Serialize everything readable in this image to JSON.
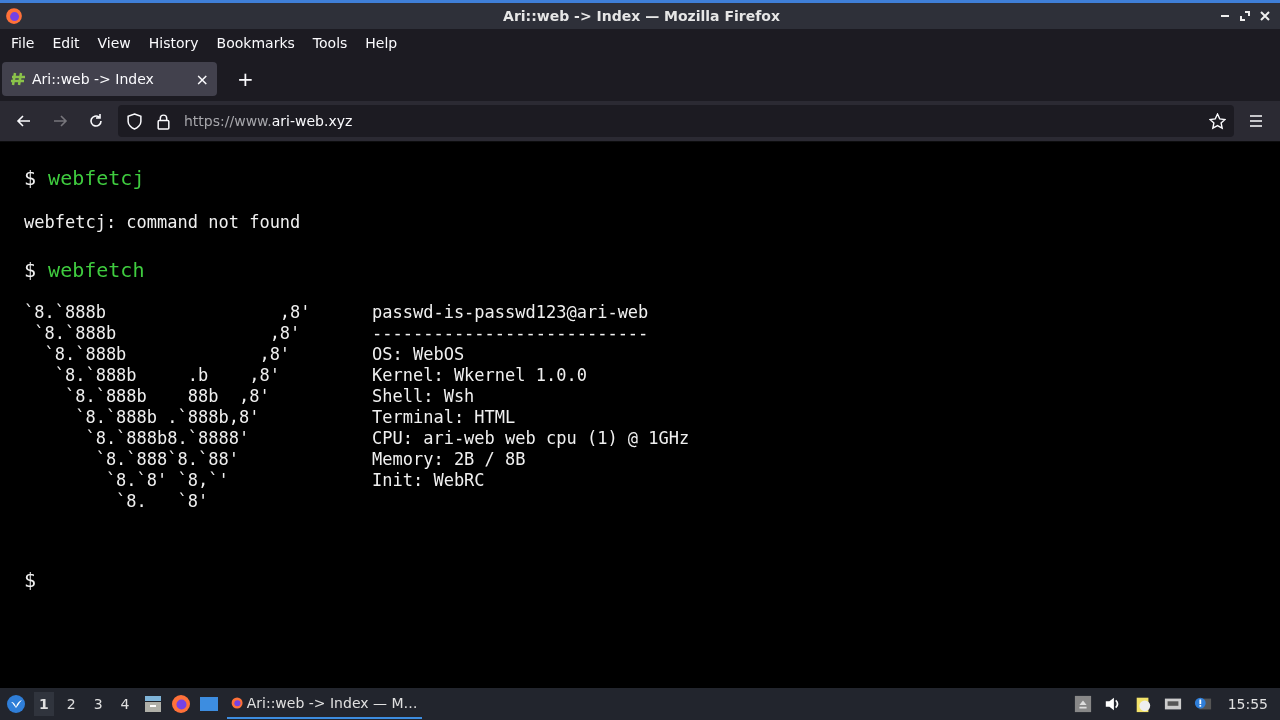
{
  "window": {
    "title": "Ari::web -> Index — Mozilla Firefox"
  },
  "menu": [
    "File",
    "Edit",
    "View",
    "History",
    "Bookmarks",
    "Tools",
    "Help"
  ],
  "tabs": [
    {
      "label": "Ari::web -> Index",
      "selected": true,
      "close": "×"
    }
  ],
  "new_tab": "+",
  "address": {
    "prefix": "https://www.",
    "host": "ari-web.xyz"
  },
  "terminal": {
    "prompt": "$",
    "entries": [
      {
        "kind": "command",
        "text": "webfetcj"
      },
      {
        "kind": "output",
        "text": "webfetcj: command not found"
      },
      {
        "kind": "command",
        "text": "webfetch"
      },
      {
        "kind": "fetch",
        "art": [
          "`8.`888b                 ,8'",
          " `8.`888b               ,8'",
          "  `8.`888b             ,8'",
          "   `8.`888b     .b    ,8'",
          "    `8.`888b    88b  ,8'",
          "     `8.`888b .`888b,8'",
          "      `8.`888b8.`8888'",
          "       `8.`888`8.`88'",
          "        `8.`8' `8,`'",
          "         `8.   `8'"
        ],
        "info": [
          "passwd-is-passwd123@ari-web",
          "---------------------------",
          "OS: WebOS",
          "Kernel: Wkernel 1.0.0",
          "Shell: Wsh",
          "Terminal: HTML",
          "CPU: ari-web web cpu (1) @ 1GHz",
          "Memory: 2B / 8B",
          "Init: WebRC"
        ]
      },
      {
        "kind": "prompt"
      }
    ]
  },
  "taskbar": {
    "workspaces": [
      {
        "label": "1",
        "selected": true
      },
      {
        "label": "2",
        "selected": false
      },
      {
        "label": "3",
        "selected": false
      },
      {
        "label": "4",
        "selected": false
      }
    ],
    "task": "Ari::web -> Index — M…",
    "clock": "15:55"
  }
}
